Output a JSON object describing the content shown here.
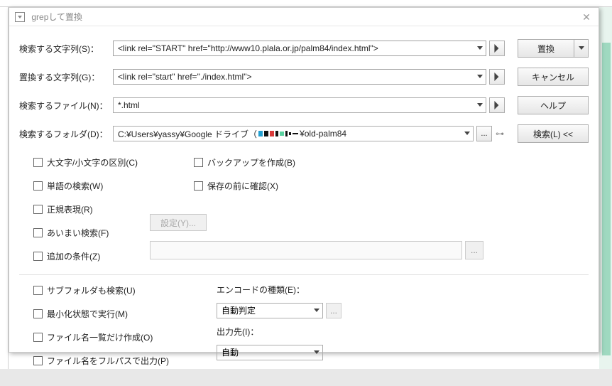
{
  "title": "grepして置換",
  "labels": {
    "search_string": "検索する文字列(S)：",
    "replace_string": "置換する文字列(G)：",
    "search_file": "検索するファイル(N)：",
    "search_folder": "検索するフォルダ(D)："
  },
  "fields": {
    "search_value": "<link rel=\"START\" href=\"http://www10.plala.or.jp/palm84/index.html\">",
    "replace_value": "<link rel=\"start\" href=\"./index.html\">",
    "file_value": "*.html",
    "folder_prefix": "C:¥Users¥yassy¥Google ドライブ（",
    "folder_suffix": "¥old-palm84"
  },
  "buttons": {
    "replace": "置換",
    "cancel": "キャンセル",
    "help": "ヘルプ",
    "search": "検索(L) <<"
  },
  "checkboxes": {
    "case": "大文字/小文字の区別(C)",
    "word": "単語の検索(W)",
    "regex": "正規表現(R)",
    "fuzzy": "あいまい検索(F)",
    "addcond": "追加の条件(Z)",
    "backup": "バックアップを作成(B)",
    "confirm": "保存の前に確認(X)",
    "subfolder": "サブフォルダも検索(U)",
    "minimized": "最小化状態で実行(M)",
    "filelist": "ファイル名一覧だけ作成(O)",
    "fullpath": "ファイル名をフルパスで出力(P)"
  },
  "settings_btn": "設定(Y)...",
  "encoding_label": "エンコードの種類(E)：",
  "encoding_value": "自動判定",
  "output_label": "出力先(I)：",
  "output_value": "自動",
  "dots": "...",
  "arrow": "▸"
}
